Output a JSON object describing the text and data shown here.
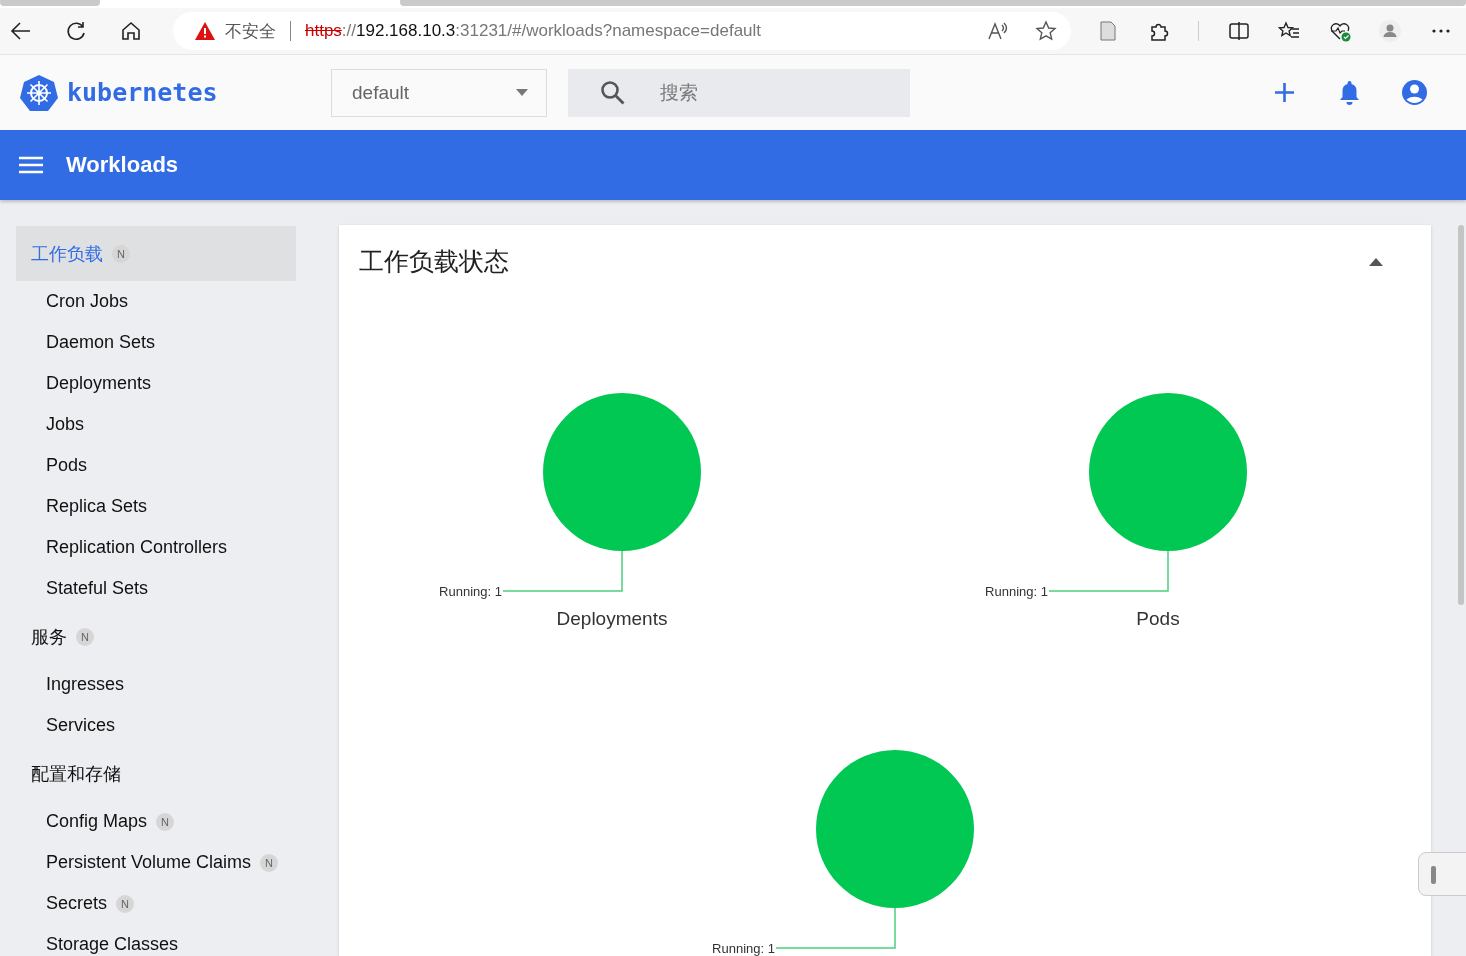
{
  "browser": {
    "address_bar": {
      "security_label": "不安全",
      "url": {
        "scheme": "https",
        "separator": "://",
        "host": "192.168.10.3",
        "path": ":31231/#/workloads?namespace=default"
      }
    }
  },
  "header": {
    "logo_text": "kubernetes",
    "namespace": {
      "value": "default"
    },
    "search": {
      "placeholder": "搜索"
    }
  },
  "toolbar": {
    "title": "Workloads"
  },
  "sidebar": {
    "sections": [
      {
        "label": "工作负载",
        "badge": "N",
        "selected": true,
        "children": [
          {
            "label": "Cron Jobs"
          },
          {
            "label": "Daemon Sets"
          },
          {
            "label": "Deployments"
          },
          {
            "label": "Jobs"
          },
          {
            "label": "Pods"
          },
          {
            "label": "Replica Sets"
          },
          {
            "label": "Replication Controllers"
          },
          {
            "label": "Stateful Sets"
          }
        ]
      },
      {
        "label": "服务",
        "badge": "N",
        "selected": false,
        "children": [
          {
            "label": "Ingresses"
          },
          {
            "label": "Services"
          }
        ]
      },
      {
        "label": "配置和存储",
        "selected": false,
        "children": [
          {
            "label": "Config Maps",
            "badge": "N"
          },
          {
            "label": "Persistent Volume Claims",
            "badge": "N"
          },
          {
            "label": "Secrets",
            "badge": "N"
          },
          {
            "label": "Storage Classes"
          }
        ]
      }
    ]
  },
  "card": {
    "title": "工作负载状态",
    "expanded": true,
    "charts": [
      {
        "title": "Deployments",
        "status_label": "Running: 1"
      },
      {
        "title": "Pods",
        "status_label": "Running: 1"
      },
      {
        "status_label": "Running: 1"
      }
    ]
  }
}
